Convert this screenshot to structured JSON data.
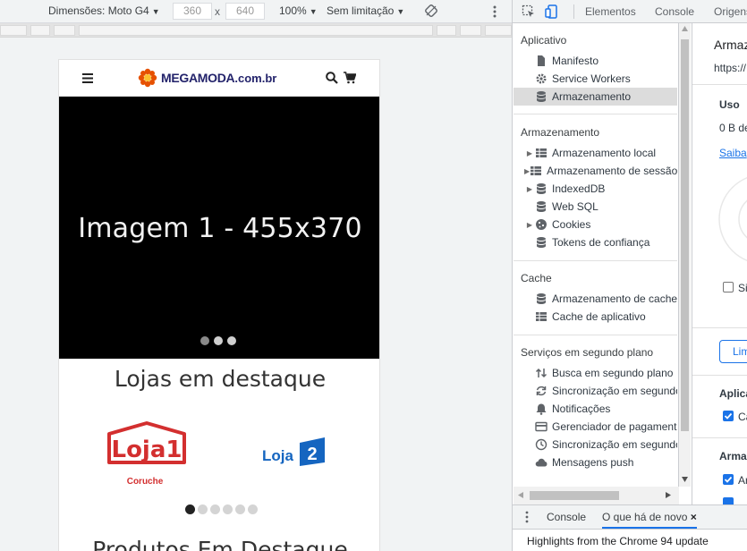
{
  "device_toolbar": {
    "dimensions_label": "Dimensões: Moto G4",
    "width": "360",
    "height": "640",
    "times": "x",
    "zoom": "100%",
    "throttle": "Sem limitação"
  },
  "site": {
    "brand": "MEGAMODA",
    "tld": ".com.br",
    "hero_caption": "Imagem 1 - 455x370",
    "stores_title": "Lojas em destaque",
    "store1_name": "Loja1",
    "store1_sub": "Coruche",
    "store2_name": "Loja",
    "store2_num": "2",
    "products_title": "Produtos Em Destaque"
  },
  "devtools": {
    "tabs": [
      "Elementos",
      "Console",
      "Origens"
    ],
    "sections": {
      "aplicativo": "Aplicativo",
      "armazenamento": "Armazenamento",
      "cache": "Cache",
      "servicos": "Serviços em segundo plano"
    },
    "aplicativo_items": [
      "Manifesto",
      "Service Workers",
      "Armazenamento"
    ],
    "armazenamento_items": [
      "Armazenamento local",
      "Armazenamento de sessão",
      "IndexedDB",
      "Web SQL",
      "Cookies",
      "Tokens de confiança"
    ],
    "cache_items": [
      "Armazenamento de cache",
      "Cache de aplicativo"
    ],
    "servicos_items": [
      "Busca em segundo plano",
      "Sincronização em segundo",
      "Notificações",
      "Gerenciador de pagament",
      "Sincronização em segundo",
      "Mensagens push"
    ],
    "main": {
      "title": "Armaz",
      "url": "https://",
      "uso": "Uso",
      "usage": "0 B de",
      "saiba": "Saiba",
      "sim": "Si",
      "limpar": "Lim",
      "aplica": "Aplica",
      "ca": "Ca",
      "armaz2": "Armaz",
      "ar": "Ar"
    },
    "drawer": {
      "console": "Console",
      "novo": "O que há de novo",
      "close": "×",
      "message": "Highlights from the Chrome 94 update"
    }
  },
  "colors": {
    "accent": "#1a73e8",
    "logo_red": "#d32f2f",
    "logo_blue": "#1565c0"
  }
}
